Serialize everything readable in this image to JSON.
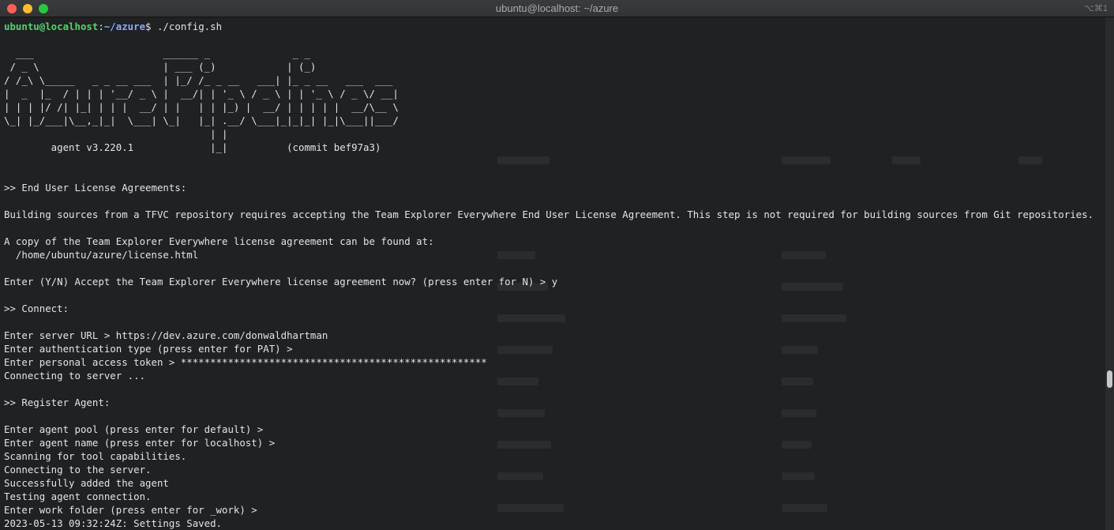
{
  "window": {
    "title": "ubuntu@localhost: ~/azure",
    "shortcut": "⌥⌘1"
  },
  "prompt": {
    "user_host": "ubuntu@localhost",
    "separator": ":",
    "path": "~/azure",
    "symbol": "$",
    "command": " ./config.sh"
  },
  "terminal": {
    "output": "\n  ___                      ______ _              _ _\n / _ \\                     | ___ (_)            | (_)\n/ /_\\ \\_____   _ _ __ ___  | |_/ /_ _ __   ___| |_ _ __   ___  ___\n|  _  |_  / | | | '__/ _ \\ |  __/| | '_ \\ / _ \\ | | '_ \\ / _ \\/ __|\n| | | |/ /| |_| | | |  __/ | |   | | |_) |  __/ | | | | |  __/\\__ \\\n\\_| |_/___|\\__,_|_|  \\___| \\_|   |_| .__/ \\___|_|_|_| |_|\\___||___/\n                                   | |\n        agent v3.220.1             |_|          (commit bef97a3)\n\n\n>> End User License Agreements:\n\nBuilding sources from a TFVC repository requires accepting the Team Explorer Everywhere End User License Agreement. This step is not required for building sources from Git repositories.\n\nA copy of the Team Explorer Everywhere license agreement can be found at:\n  /home/ubuntu/azure/license.html\n\nEnter (Y/N) Accept the Team Explorer Everywhere license agreement now? (press enter for N) > y\n\n>> Connect:\n\nEnter server URL > https://dev.azure.com/donwaldhartman\nEnter authentication type (press enter for PAT) >\nEnter personal access token > ****************************************************\nConnecting to server ...\n\n>> Register Agent:\n\nEnter agent pool (press enter for default) >\nEnter agent name (press enter for localhost) >\nScanning for tool capabilities.\nConnecting to the server.\nSuccessfully added the agent\nTesting agent connection.\nEnter work folder (press enter for _work) >\n2023-05-13 09:32:24Z: Settings Saved."
  }
}
